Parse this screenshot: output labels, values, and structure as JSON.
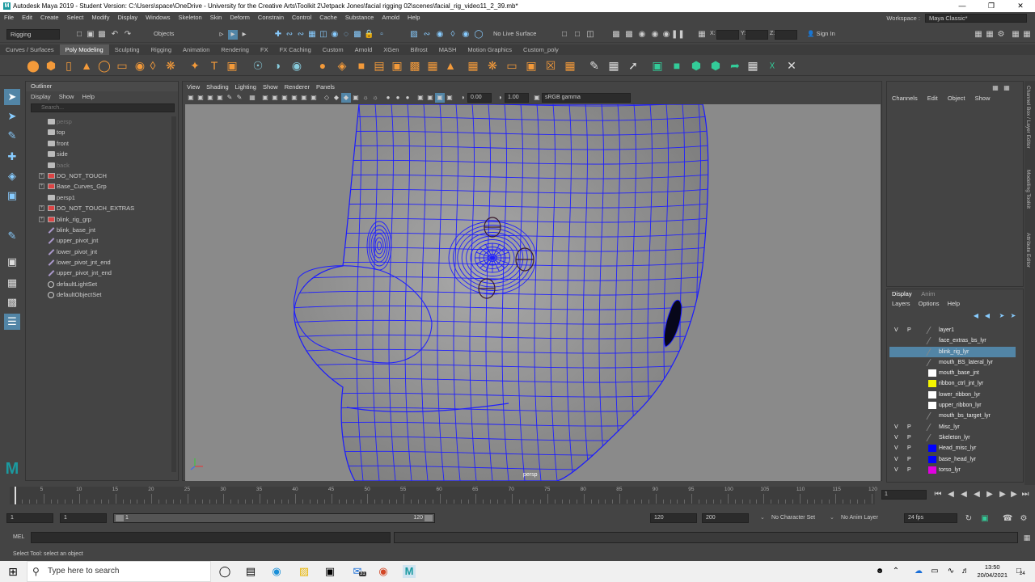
{
  "window": {
    "title": "Autodesk Maya 2019 - Student Version: C:\\Users\\space\\OneDrive - University for the Creative Arts\\Toolkit 2\\Jetpack Jones\\facial rigging 02\\scenes\\facial_rig_video11_2_39.mb*"
  },
  "menubar": [
    "File",
    "Edit",
    "Create",
    "Select",
    "Modify",
    "Display",
    "Windows",
    "Skeleton",
    "Skin",
    "Deform",
    "Constrain",
    "Control",
    "Cache",
    "Substance",
    "Arnold",
    "Help"
  ],
  "workspace": {
    "label": "Workspace :",
    "value": "Maya Classic*"
  },
  "statusline": {
    "menuset": "Rigging",
    "objects": "Objects",
    "live_surface": "No Live Surface",
    "x_label": "X:",
    "y_label": "Y:",
    "z_label": "Z:",
    "sign_in": "Sign In"
  },
  "shelf_tabs": [
    "Curves / Surfaces",
    "Poly Modeling",
    "Sculpting",
    "Rigging",
    "Animation",
    "Rendering",
    "FX",
    "FX Caching",
    "Custom",
    "Arnold",
    "XGen",
    "Bifrost",
    "MASH",
    "Motion Graphics",
    "Custom_poly"
  ],
  "shelf_active": "Poly Modeling",
  "outliner": {
    "title": "Outliner",
    "menu": [
      "Display",
      "Show",
      "Help"
    ],
    "search_placeholder": "Search...",
    "items": [
      {
        "name": "persp",
        "type": "camera",
        "dim": true,
        "expand": false
      },
      {
        "name": "top",
        "type": "camera",
        "dim": false,
        "expand": false
      },
      {
        "name": "front",
        "type": "camera",
        "dim": false,
        "expand": false
      },
      {
        "name": "side",
        "type": "camera",
        "dim": false,
        "expand": false
      },
      {
        "name": "back",
        "type": "camera",
        "dim": true,
        "expand": false
      },
      {
        "name": "DO_NOT_TOUCH",
        "type": "group",
        "dim": false,
        "expand": true
      },
      {
        "name": "Base_Curves_Grp",
        "type": "group",
        "dim": false,
        "expand": true
      },
      {
        "name": "persp1",
        "type": "camera",
        "dim": false,
        "expand": false
      },
      {
        "name": "DO_NOT_TOUCH_EXTRAS",
        "type": "group",
        "dim": false,
        "expand": true
      },
      {
        "name": "blink_rig_grp",
        "type": "group",
        "dim": false,
        "expand": true
      },
      {
        "name": "blink_base_jnt",
        "type": "joint",
        "dim": false,
        "expand": false
      },
      {
        "name": "upper_pivot_jnt",
        "type": "joint",
        "dim": false,
        "expand": false
      },
      {
        "name": "lower_pivot_jnt",
        "type": "joint",
        "dim": false,
        "expand": false
      },
      {
        "name": "lower_pivot_jnt_end",
        "type": "joint",
        "dim": false,
        "expand": false
      },
      {
        "name": "upper_pivot_jnt_end",
        "type": "joint",
        "dim": false,
        "expand": false
      },
      {
        "name": "defaultLightSet",
        "type": "set",
        "dim": false,
        "expand": false
      },
      {
        "name": "defaultObjectSet",
        "type": "set",
        "dim": false,
        "expand": false
      }
    ]
  },
  "viewport": {
    "menu": [
      "View",
      "Shading",
      "Lighting",
      "Show",
      "Renderer",
      "Panels"
    ],
    "exposure": "0.00",
    "gamma": "1.00",
    "color_space": "sRGB gamma",
    "camera": "persp"
  },
  "channelbox": {
    "menu": [
      "Channels",
      "Edit",
      "Object",
      "Show"
    ]
  },
  "side_tabs": [
    "Channel Box / Layer Editor",
    "Modelling Toolkit",
    "Attribute Editor"
  ],
  "layer_editor": {
    "tabs": [
      "Display",
      "Anim"
    ],
    "menu": [
      "Layers",
      "Options",
      "Help"
    ],
    "layers": [
      {
        "v": "V",
        "p": "P",
        "name": "layer1",
        "color": "",
        "sel": false
      },
      {
        "v": "",
        "p": "",
        "name": "face_extras_bs_lyr",
        "color": "",
        "sel": false
      },
      {
        "v": "",
        "p": "",
        "name": "blink_rig_lyr",
        "color": "",
        "sel": true
      },
      {
        "v": "",
        "p": "",
        "name": "mouth_BS_lateral_lyr",
        "color": "",
        "sel": false
      },
      {
        "v": "",
        "p": "",
        "name": "mouth_base_jnt",
        "color": "#ffffff",
        "sel": false
      },
      {
        "v": "",
        "p": "",
        "name": "ribbon_ctrl_jnt_lyr",
        "color": "#f5f500",
        "sel": false
      },
      {
        "v": "",
        "p": "",
        "name": "lower_ribbon_lyr",
        "color": "#ffffff",
        "sel": false
      },
      {
        "v": "",
        "p": "",
        "name": "upper_ribbon_lyr",
        "color": "#ffffff",
        "sel": false
      },
      {
        "v": "",
        "p": "",
        "name": "mouth_bs_target_lyr",
        "color": "",
        "sel": false
      },
      {
        "v": "V",
        "p": "P",
        "name": "Misc_lyr",
        "color": "",
        "sel": false
      },
      {
        "v": "V",
        "p": "P",
        "name": "Skeleton_lyr",
        "color": "",
        "sel": false
      },
      {
        "v": "V",
        "p": "P",
        "name": "Head_misc_lyr",
        "color": "#0000ff",
        "sel": false
      },
      {
        "v": "V",
        "p": "P",
        "name": "base_head_lyr",
        "color": "#0000ff",
        "sel": false
      },
      {
        "v": "V",
        "p": "P",
        "name": "torso_lyr",
        "color": "#e000e0",
        "sel": false
      }
    ]
  },
  "timeslider": {
    "ticks": [
      "5",
      "10",
      "15",
      "20",
      "25",
      "30",
      "35",
      "40",
      "45",
      "50",
      "55",
      "60",
      "65",
      "70",
      "75",
      "80",
      "85",
      "90",
      "95",
      "100",
      "105",
      "110",
      "115",
      "120"
    ],
    "current_frame": "1"
  },
  "range": {
    "start": "1",
    "anim_start": "1",
    "range_start": "1",
    "range_end": "120",
    "end": "120",
    "anim_end": "200",
    "character_set": "No Character Set",
    "anim_layer": "No Anim Layer",
    "fps": "24 fps"
  },
  "mel": {
    "label": "MEL"
  },
  "helpline": "Select Tool: select an object",
  "taskbar": {
    "search_placeholder": "Type here to search",
    "time": "13:50",
    "date": "20/04/2021",
    "notif_count": "24",
    "mail_badge": "31"
  }
}
